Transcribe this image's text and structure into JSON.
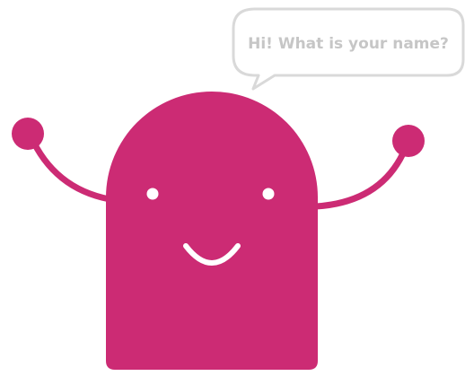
{
  "speech_bubble": {
    "text": "Hi! What is your name?"
  },
  "colors": {
    "character": "#CC2B74",
    "bubble_border": "#D9D9D9",
    "bubble_text": "#C6C6C6",
    "background": "#FFFFFF",
    "face": "#FFFFFF"
  },
  "icons": {
    "character": "smiling-monster-mascot"
  }
}
